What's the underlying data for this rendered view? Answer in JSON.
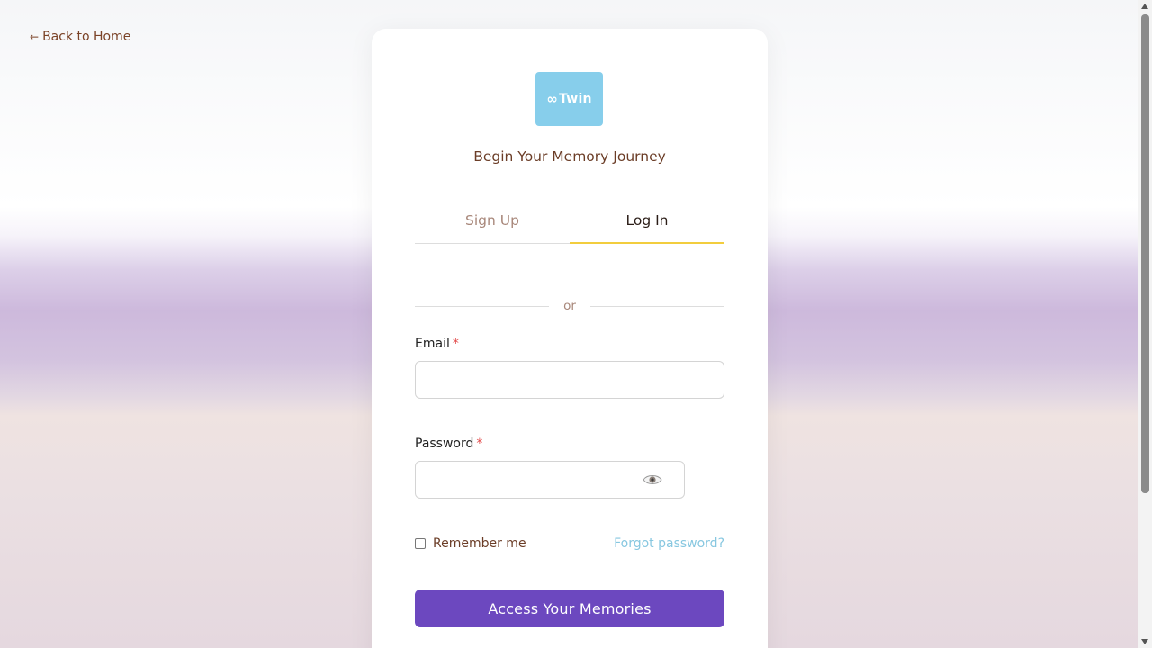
{
  "nav": {
    "back_label": "Back to Home",
    "back_arrow": "←"
  },
  "logo": {
    "text": "Twin",
    "symbol": "∞",
    "color": "#87ceeb"
  },
  "subtitle": "Begin Your Memory Journey",
  "tabs": [
    {
      "label": "Sign Up",
      "active": false
    },
    {
      "label": "Log In",
      "active": true
    }
  ],
  "divider": {
    "text": "or"
  },
  "form": {
    "email": {
      "label": "Email",
      "required_marker": "*",
      "value": "",
      "placeholder": ""
    },
    "password": {
      "label": "Password",
      "required_marker": "*",
      "value": "",
      "placeholder": "",
      "toggle_icon": "eye-icon"
    },
    "remember_label": "Remember me",
    "remember_checked": false,
    "forgot_label": "Forgot password?",
    "submit_label": "Access Your Memories"
  },
  "colors": {
    "accent": "#6c48bf",
    "tab_underline": "#f2cd3e",
    "link": "#87c7e0",
    "text_brown": "#6b3d27",
    "required": "#e24a4a"
  }
}
